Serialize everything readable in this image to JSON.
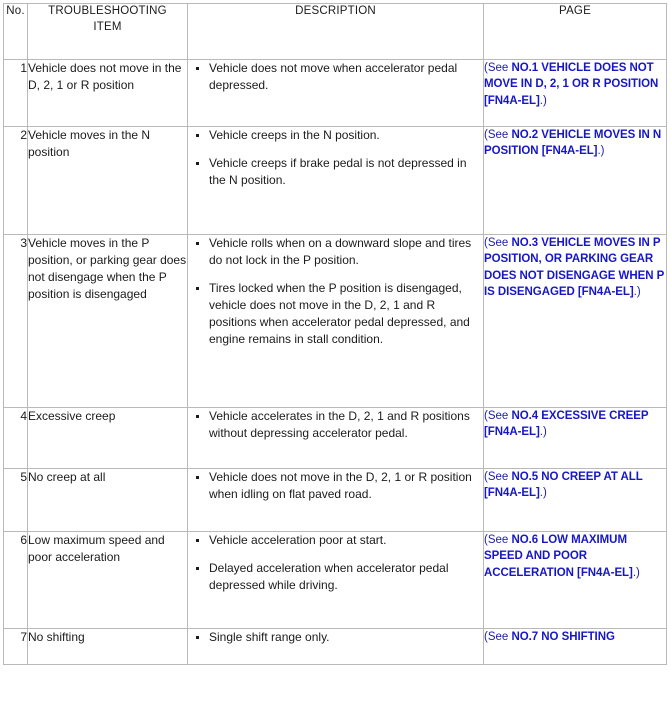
{
  "table": {
    "headers": {
      "no": "No.",
      "item_line1": "TROUBLESHOOTING",
      "item_line2": "ITEM",
      "description": "DESCRIPTION",
      "page": "PAGE"
    },
    "colors": {
      "border": "#b9b9b9",
      "text": "#1b1b1b",
      "ref_lead": "#1d1da8",
      "ref_link": "#1616c9"
    },
    "rows": [
      {
        "no": "1",
        "item": "Vehicle does not move in the D, 2, 1 or R position",
        "description": [
          "Vehicle does not move when accelerator pedal depressed."
        ],
        "page": {
          "lead": "(See ",
          "link": "NO.1 VEHICLE DOES NOT MOVE IN D, 2, 1 OR R POSITION [FN4A-EL]",
          "tail": ".)"
        }
      },
      {
        "no": "2",
        "item": "Vehicle moves in the N position",
        "description": [
          "Vehicle creeps in the N position.",
          "Vehicle creeps if brake pedal is not depressed in the N position."
        ],
        "page": {
          "lead": "(See ",
          "link": "NO.2 VEHICLE MOVES IN N POSITION [FN4A-EL]",
          "tail": ".)"
        }
      },
      {
        "no": "3",
        "item": "Vehicle moves in the P position, or parking gear does not disengage when the P position is disengaged",
        "description": [
          "Vehicle rolls when on a downward slope and tires do not lock in the P position.",
          "Tires locked when the P position is disengaged, vehicle does not move in the D, 2, 1 and R positions when accelerator pedal depressed, and engine remains in stall condition."
        ],
        "page": {
          "lead": "(See ",
          "link": "NO.3 VEHICLE MOVES IN P POSITION, OR PARKING GEAR DOES NOT DISENGAGE WHEN P IS DISENGAGED [FN4A-EL]",
          "tail": ".)"
        }
      },
      {
        "no": "4",
        "item": "Excessive creep",
        "description": [
          "Vehicle accelerates in the D, 2, 1 and R positions without depressing accelerator pedal."
        ],
        "page": {
          "lead": "(See ",
          "link": "NO.4 EXCESSIVE CREEP [FN4A-EL]",
          "tail": ".)"
        }
      },
      {
        "no": "5",
        "item": "No creep at all",
        "description": [
          "Vehicle does not move in the D, 2, 1 or R position when idling on flat paved road."
        ],
        "page": {
          "lead": "(See ",
          "link": "NO.5 NO CREEP AT ALL [FN4A-EL]",
          "tail": ".)"
        }
      },
      {
        "no": "6",
        "item": "Low maximum speed and poor acceleration",
        "description": [
          "Vehicle acceleration poor at start.",
          "Delayed acceleration when accelerator pedal depressed while driving."
        ],
        "page": {
          "lead": "(See ",
          "link": "NO.6 LOW MAXIMUM SPEED AND POOR ACCELERATION [FN4A-EL]",
          "tail": ".)"
        }
      },
      {
        "no": "7",
        "item": "No shifting",
        "description": [
          "Single shift range only."
        ],
        "page": {
          "lead": "(See ",
          "link": "NO.7 NO SHIFTING",
          "tail": ""
        }
      }
    ]
  }
}
